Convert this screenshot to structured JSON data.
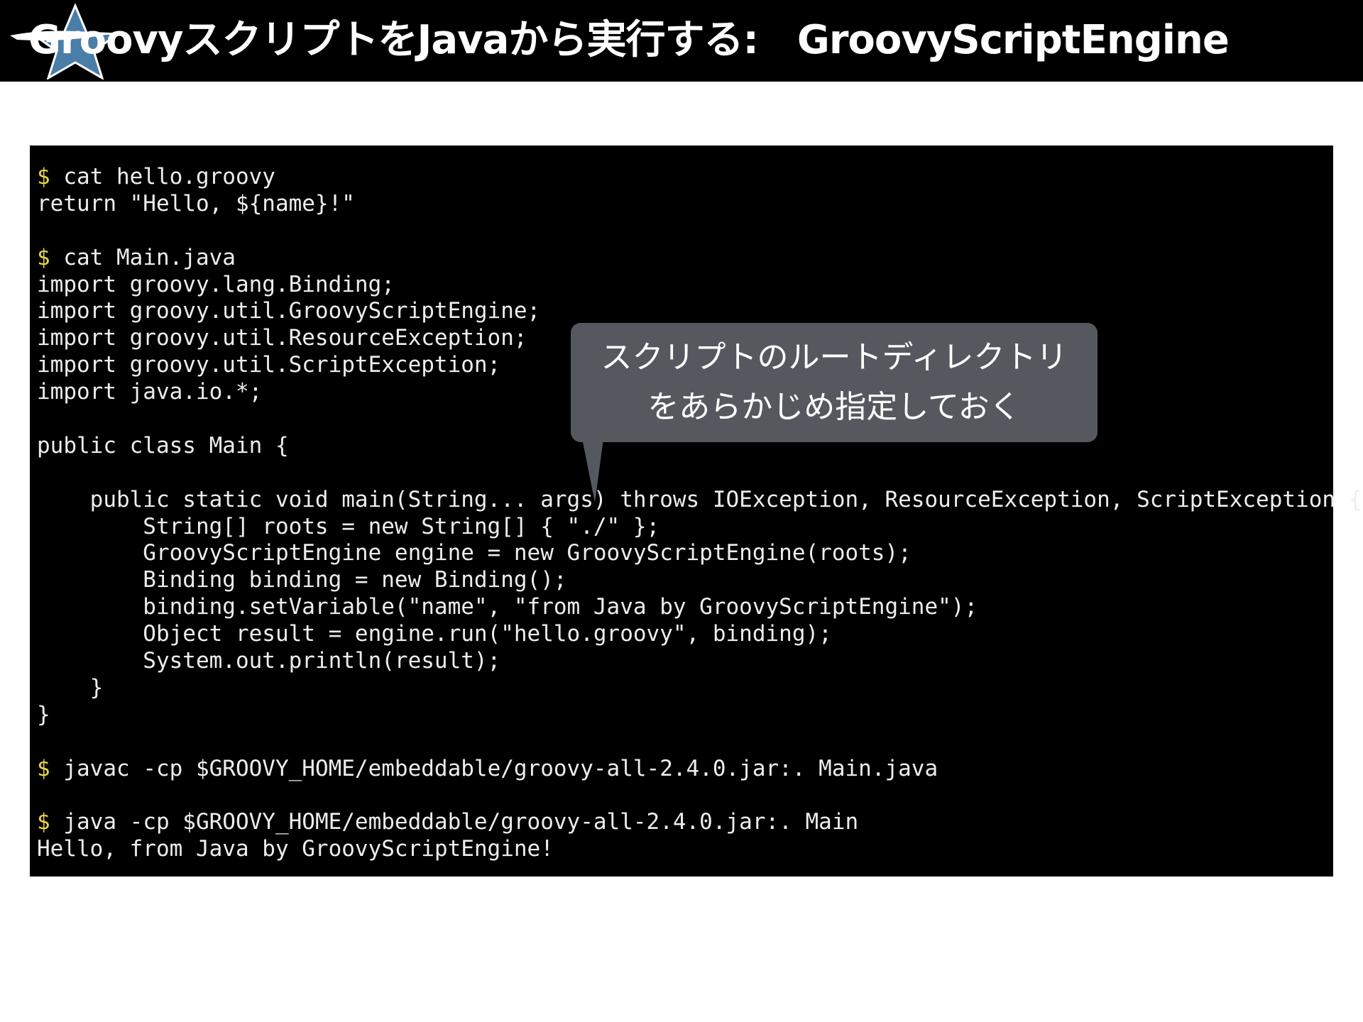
{
  "slide": {
    "title": "GroovyスクリプトをJavaから実行する:　GroovyScriptEngine",
    "logo_icon": "groovy-star-logo-icon"
  },
  "terminal": {
    "prompt_color": "#e8d44a",
    "lines": [
      {
        "prompt": "$",
        "text": " cat hello.groovy"
      },
      {
        "prompt": "",
        "text": "return \"Hello, ${name}!\""
      },
      {
        "prompt": "",
        "text": ""
      },
      {
        "prompt": "$",
        "text": " cat Main.java"
      },
      {
        "prompt": "",
        "text": "import groovy.lang.Binding;"
      },
      {
        "prompt": "",
        "text": "import groovy.util.GroovyScriptEngine;"
      },
      {
        "prompt": "",
        "text": "import groovy.util.ResourceException;"
      },
      {
        "prompt": "",
        "text": "import groovy.util.ScriptException;"
      },
      {
        "prompt": "",
        "text": "import java.io.*;"
      },
      {
        "prompt": "",
        "text": ""
      },
      {
        "prompt": "",
        "text": "public class Main {"
      },
      {
        "prompt": "",
        "text": ""
      },
      {
        "prompt": "",
        "text": "    public static void main(String... args) throws IOException, ResourceException, ScriptException {"
      },
      {
        "prompt": "",
        "text": "        String[] roots = new String[] { \"./\" };"
      },
      {
        "prompt": "",
        "text": "        GroovyScriptEngine engine = new GroovyScriptEngine(roots);"
      },
      {
        "prompt": "",
        "text": "        Binding binding = new Binding();"
      },
      {
        "prompt": "",
        "text": "        binding.setVariable(\"name\", \"from Java by GroovyScriptEngine\");"
      },
      {
        "prompt": "",
        "text": "        Object result = engine.run(\"hello.groovy\", binding);"
      },
      {
        "prompt": "",
        "text": "        System.out.println(result);"
      },
      {
        "prompt": "",
        "text": "    }"
      },
      {
        "prompt": "",
        "text": "}"
      },
      {
        "prompt": "",
        "text": ""
      },
      {
        "prompt": "$",
        "text": " javac -cp $GROOVY_HOME/embeddable/groovy-all-2.4.0.jar:. Main.java"
      },
      {
        "prompt": "",
        "text": ""
      },
      {
        "prompt": "$",
        "text": " java -cp $GROOVY_HOME/embeddable/groovy-all-2.4.0.jar:. Main"
      },
      {
        "prompt": "",
        "text": "Hello, from Java by GroovyScriptEngine!"
      }
    ]
  },
  "callout": {
    "line1": "スクリプトのルートディレクトリ",
    "line2": "をあらかじめ指定しておく"
  }
}
